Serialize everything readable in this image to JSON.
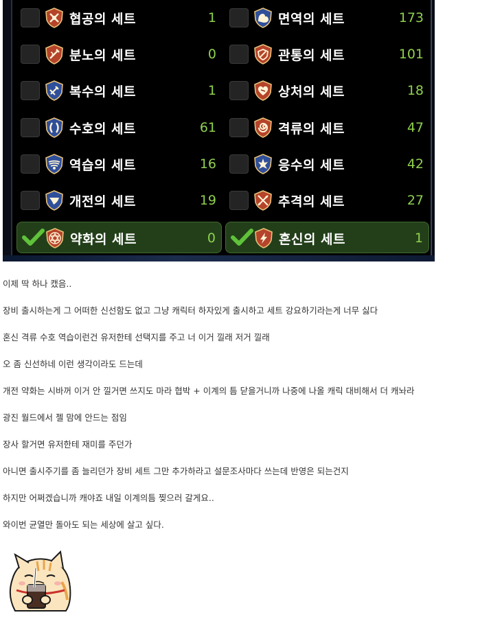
{
  "sets": [
    {
      "name": "협공의 세트",
      "count": "1",
      "icon": "crossed-blades-icon",
      "checked": false
    },
    {
      "name": "면역의 세트",
      "count": "173",
      "icon": "flexed-arm-icon",
      "checked": false
    },
    {
      "name": "분노의 세트",
      "count": "0",
      "icon": "sword-slash-icon",
      "checked": false
    },
    {
      "name": "관통의 세트",
      "count": "101",
      "icon": "pierce-shield-icon",
      "checked": false
    },
    {
      "name": "복수의 세트",
      "count": "1",
      "icon": "revenge-sword-icon",
      "checked": false
    },
    {
      "name": "상처의 세트",
      "count": "18",
      "icon": "heart-wound-icon",
      "checked": false
    },
    {
      "name": "수호의 세트",
      "count": "61",
      "icon": "guard-shield-icon",
      "checked": false
    },
    {
      "name": "격류의 세트",
      "count": "47",
      "icon": "swirl-icon",
      "checked": false
    },
    {
      "name": "역습의 세트",
      "count": "16",
      "icon": "wing-emblem-icon",
      "checked": false
    },
    {
      "name": "응수의 세트",
      "count": "42",
      "icon": "fleur-icon",
      "checked": false
    },
    {
      "name": "개전의 세트",
      "count": "19",
      "icon": "horn-icon",
      "checked": false
    },
    {
      "name": "추격의 세트",
      "count": "27",
      "icon": "crossed-swords-icon",
      "checked": false
    },
    {
      "name": "약화의 세트",
      "count": "0",
      "icon": "hexagram-icon",
      "checked": true
    },
    {
      "name": "혼신의 세트",
      "count": "1",
      "icon": "lightning-icon",
      "checked": true
    }
  ],
  "colors": {
    "count": "#8fd14f",
    "selected_bg": "#233f1a",
    "check": "#5fc23a"
  },
  "post": {
    "lines": [
      "이제 딱 하나 캤음..",
      "장비 출시하는게 그 어떠한 신선함도 없고 그냥 캐릭터 하자있게 출시하고 세트 강요하기라는게 너무 싫다",
      "혼신 격류 수호 역습이런건 유저한테 선택지를 주고 너 이거 낄래 저거 낄래",
      "오 좀 신선하네 이런 생각이라도 드는데",
      "개전 약화는 시바꺼 이거 안 낄거면 쓰지도 마라 협박 + 이계의 틈 닫을거니까 나중에 나올 캐릭 대비해서 더 캐놔라",
      "광진 월드에서 젤 맘에 안드는 점임",
      "장사 할거면 유저한테 재미를 주던가",
      "아니면 출시주기를 좀 늘리던가 장비 세트 그만 추가하라고 설문조사마다 쓰는데 반영은 되는건지",
      "하지만 어쩌겠습니까 캐야죠 내일 이계의틈 찢으러 갈게요..",
      "와이번 균열만 돌아도 되는 세상에 살고 싶다."
    ]
  },
  "sticker": {
    "icon": "cat-drinking-sticker"
  }
}
